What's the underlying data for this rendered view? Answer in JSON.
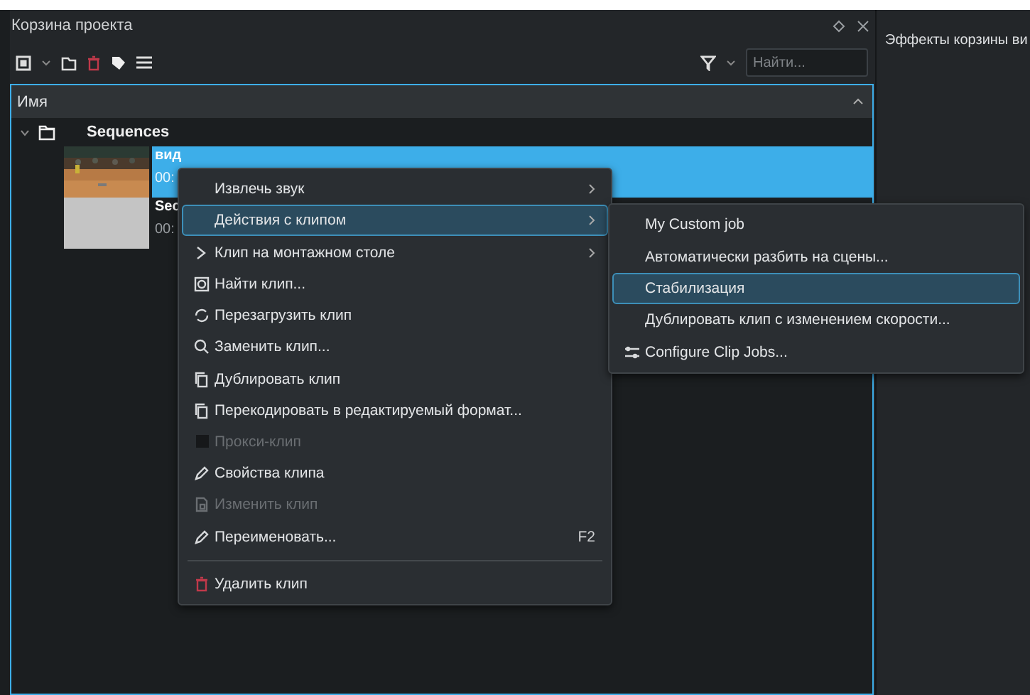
{
  "panel": {
    "title": "Корзина проекта",
    "search": {
      "placeholder": "Найти..."
    },
    "column_header": "Имя"
  },
  "tree": [
    {
      "name": "Sequences",
      "expanded": true,
      "children": [
        {
          "name": "вид",
          "duration": "00:",
          "selected": true,
          "kind": "video"
        },
        {
          "name": "Sec",
          "duration": "00:",
          "selected": false,
          "kind": "sequence"
        }
      ]
    }
  ],
  "side_panel": {
    "title": "Эффекты корзины ви"
  },
  "context_menu": {
    "items": [
      {
        "kind": "action",
        "label": "Извлечь звук",
        "submenu": true,
        "selected": false,
        "disabled": false
      },
      {
        "kind": "action",
        "label": "Действия с клипом",
        "submenu": true,
        "selected": true,
        "disabled": false
      },
      {
        "kind": "action",
        "label": "Клип на монтажном столе",
        "submenu": true,
        "selected": false,
        "disabled": false
      },
      {
        "kind": "action",
        "label": "Найти клип...",
        "submenu": false,
        "selected": false,
        "disabled": false
      },
      {
        "kind": "action",
        "label": "Перезагрузить клип",
        "submenu": false,
        "selected": false,
        "disabled": false
      },
      {
        "kind": "action",
        "label": "Заменить клип...",
        "submenu": false,
        "selected": false,
        "disabled": false
      },
      {
        "kind": "action",
        "label": "Дублировать клип",
        "submenu": false,
        "selected": false,
        "disabled": false
      },
      {
        "kind": "action",
        "label": "Перекодировать в редактируемый формат...",
        "submenu": false,
        "selected": false,
        "disabled": false
      },
      {
        "kind": "checkbox",
        "label": "Прокси-клип",
        "checked": false,
        "submenu": false,
        "selected": false,
        "disabled": true
      },
      {
        "kind": "action",
        "label": "Свойства клипа",
        "submenu": false,
        "selected": false,
        "disabled": false
      },
      {
        "kind": "action",
        "label": "Изменить клип",
        "submenu": false,
        "selected": false,
        "disabled": true
      },
      {
        "kind": "action",
        "label": "Переименовать...",
        "shortcut": "F2",
        "submenu": false,
        "selected": false,
        "disabled": false
      },
      {
        "kind": "separator"
      },
      {
        "kind": "action",
        "label": "Удалить клип",
        "submenu": false,
        "selected": false,
        "disabled": false
      }
    ]
  },
  "submenu": {
    "items": [
      {
        "label": "My Custom job",
        "selected": false
      },
      {
        "label": "Автоматически разбить на сцены...",
        "selected": false
      },
      {
        "label": "Стабилизация",
        "selected": true
      },
      {
        "label": "Дублировать клип с изменением скорости...",
        "selected": false
      },
      {
        "label": "Configure Clip Jobs...",
        "selected": false
      }
    ]
  }
}
